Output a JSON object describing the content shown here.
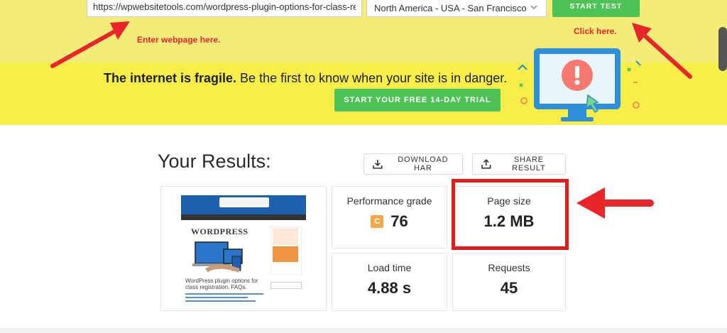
{
  "test_form": {
    "url_value": "https://wpwebsitetools.com/wordpress-plugin-options-for-class-regist",
    "region_value": "North America - USA - San Francisco",
    "start_label": "START TEST"
  },
  "annotations": {
    "enter_webpage": "Enter webpage here.",
    "click_here": "Click here."
  },
  "promo": {
    "bold_text": "The internet is fragile.",
    "rest_text": " Be the first to know when your site is in danger.",
    "trial_label": "START YOUR FREE 14-DAY TRIAL"
  },
  "results": {
    "title": "Your Results:",
    "download_label": "DOWNLOAD HAR",
    "share_label": "SHARE RESULT",
    "grade_label": "Performance grade",
    "grade_letter": "C",
    "grade_value": "76",
    "size_label": "Page size",
    "size_value": "1.2 MB",
    "load_label": "Load time",
    "load_value": "4.88 s",
    "requests_label": "Requests",
    "requests_value": "45"
  },
  "thumbnail": {
    "wordpress_text": "WORDPRESS",
    "caption": "WordPress plugin options for class registration. FAQs."
  },
  "colors": {
    "top_band": "#f3ec78",
    "promo_band": "#f7ee4a",
    "button_green": "#4cc354",
    "annotation_red": "#e8262a",
    "grade_orange": "#f4a64a"
  }
}
